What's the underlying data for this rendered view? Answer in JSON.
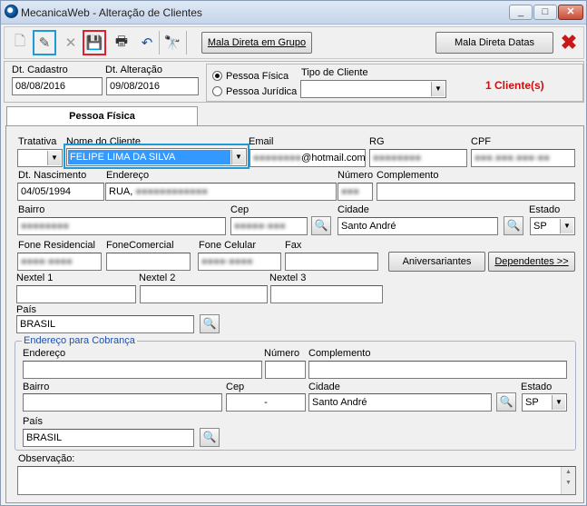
{
  "window": {
    "title": "MecanicaWeb - Alteração de Clientes",
    "minimize": "_",
    "maximize": "□",
    "close": "✕"
  },
  "toolbar": {
    "new_icon": "🗋",
    "edit_icon": "✎",
    "delete_icon": "✕",
    "save_icon": "💾",
    "print_icon": "🖶",
    "undo_icon": "↶",
    "find_icon": "🔭",
    "mala_grupo": "Mala Direta em Grupo",
    "mala_datas": "Mala Direta Datas",
    "exit_icon": "✖"
  },
  "header": {
    "dt_cadastro_label": "Dt. Cadastro",
    "dt_cadastro": "08/08/2016",
    "dt_alteracao_label": "Dt. Alteração",
    "dt_alteracao": "09/08/2016",
    "pessoa_fisica": "Pessoa Física",
    "pessoa_juridica": "Pessoa Jurídica",
    "tipo_cliente_label": "Tipo de Cliente",
    "tipo_cliente": "",
    "count": "1 Cliente(s)"
  },
  "tab": {
    "label": "Pessoa Física"
  },
  "form": {
    "tratativa_label": "Tratativa",
    "tratativa": "",
    "nome_label": "Nome do Cliente",
    "nome": "FELIPE LIMA DA SILVA",
    "email_label": "Email",
    "email_visible": "@hotmail.com",
    "rg_label": "RG",
    "cpf_label": "CPF",
    "dt_nasc_label": "Dt. Nascimento",
    "dt_nasc": "04/05/1994",
    "endereco_label": "Endereço",
    "endereco": "RUA,",
    "numero_label": "Número",
    "complemento_label": "Complemento",
    "bairro_label": "Bairro",
    "cep_label": "Cep",
    "cidade_label": "Cidade",
    "cidade": "Santo André",
    "estado_label": "Estado",
    "estado": "SP",
    "fone_res_label": "Fone Residencial",
    "fone_com_label": "FoneComercial",
    "fone_cel_label": "Fone Celular",
    "fax_label": "Fax",
    "aniversariantes": "Aniversariantes",
    "dependentes": "Dependentes >>",
    "nextel1_label": "Nextel 1",
    "nextel2_label": "Nextel 2",
    "nextel3_label": "Nextel 3",
    "pais_label": "País",
    "pais": "BRASIL",
    "search_icon": "🔍"
  },
  "cobranca": {
    "title": "Endereço para Cobrança",
    "endereco_label": "Endereço",
    "numero_label": "Número",
    "complemento_label": "Complemento",
    "bairro_label": "Bairro",
    "cep_label": "Cep",
    "cep": "-",
    "cidade_label": "Cidade",
    "cidade": "Santo André",
    "estado_label": "Estado",
    "estado": "SP",
    "pais_label": "País",
    "pais": "BRASIL"
  },
  "obs": {
    "label": "Observação:"
  }
}
